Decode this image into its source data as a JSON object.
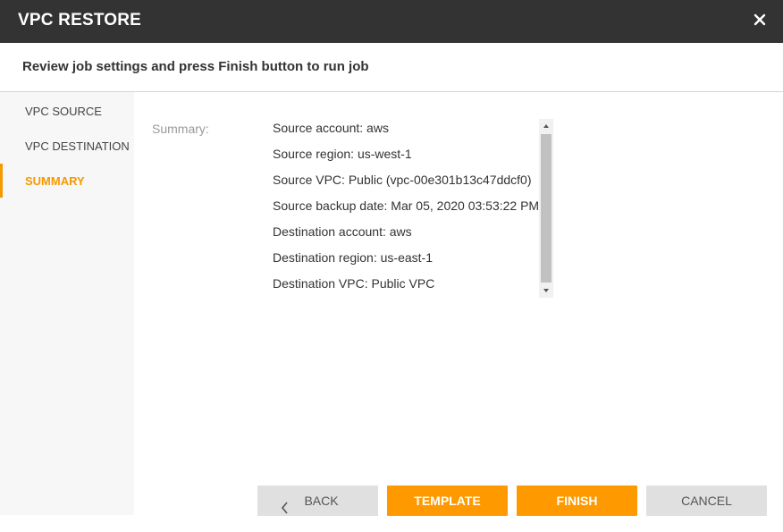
{
  "window": {
    "title": "VPC RESTORE",
    "close_icon": "close-icon"
  },
  "header": {
    "instruction": "Review job settings and press Finish button to run job"
  },
  "sidebar": {
    "items": [
      {
        "label": "VPC SOURCE",
        "active": false
      },
      {
        "label": "VPC DESTINATION",
        "active": false
      },
      {
        "label": "SUMMARY",
        "active": true
      }
    ]
  },
  "summary": {
    "label": "Summary:",
    "lines": [
      "Source account: aws",
      "Source region: us-west-1",
      "Source VPC: Public (vpc-00e301b13c47ddcf0)",
      "Source backup date: Mar 05, 2020 03:53:22 PM",
      "Destination account: aws",
      "Destination region: us-east-1",
      "Destination VPC: Public VPC"
    ]
  },
  "buttons": {
    "back": "BACK",
    "template": "TEMPLATE",
    "finish": "FINISH",
    "cancel": "CANCEL"
  },
  "colors": {
    "accent": "#ff9900",
    "titlebar": "#333333"
  }
}
